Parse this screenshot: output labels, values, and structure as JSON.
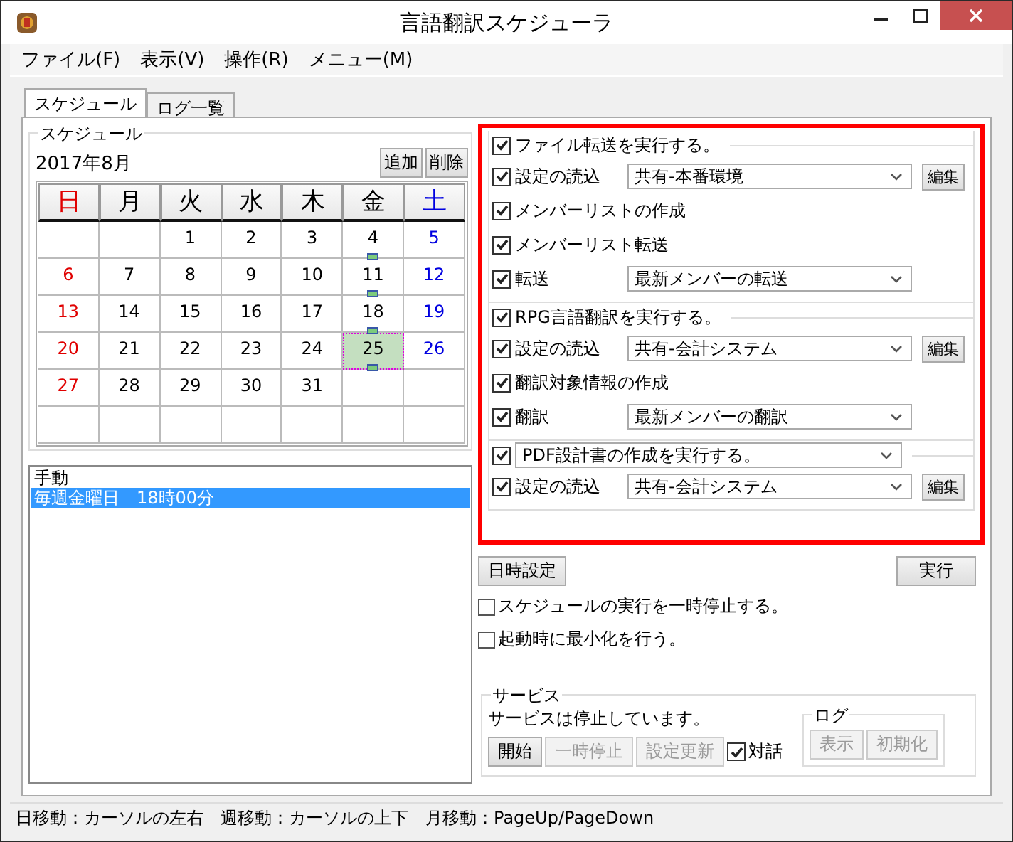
{
  "window": {
    "title": "言語翻訳スケジューラ"
  },
  "menu": [
    "ファイル(F)",
    "表示(V)",
    "操作(R)",
    "メニュー(M)"
  ],
  "tabs": [
    {
      "label": "スケジュール",
      "selected": true
    },
    {
      "label": "ログ一覧",
      "selected": false
    }
  ],
  "schedule": {
    "group_title": "スケジュール",
    "month": "2017年8月",
    "add_button": "追加",
    "delete_button": "削除",
    "weekdays": [
      {
        "label": "日",
        "kind": "sunday"
      },
      {
        "label": "月",
        "kind": "weekday"
      },
      {
        "label": "火",
        "kind": "weekday"
      },
      {
        "label": "水",
        "kind": "weekday"
      },
      {
        "label": "木",
        "kind": "weekday"
      },
      {
        "label": "金",
        "kind": "weekday"
      },
      {
        "label": "土",
        "kind": "saturday"
      }
    ],
    "weeks": [
      [
        {
          "kind": "blank"
        },
        {
          "kind": "blank"
        },
        {
          "day": "1",
          "kind": "weekday",
          "marked": false,
          "selected": false
        },
        {
          "day": "2",
          "kind": "weekday",
          "marked": false,
          "selected": false
        },
        {
          "day": "3",
          "kind": "weekday",
          "marked": false,
          "selected": false
        },
        {
          "day": "4",
          "kind": "weekday",
          "marked": true,
          "selected": false
        },
        {
          "day": "5",
          "kind": "saturday",
          "marked": false,
          "selected": false
        }
      ],
      [
        {
          "day": "6",
          "kind": "sunday",
          "marked": false,
          "selected": false
        },
        {
          "day": "7",
          "kind": "weekday",
          "marked": false,
          "selected": false
        },
        {
          "day": "8",
          "kind": "weekday",
          "marked": false,
          "selected": false
        },
        {
          "day": "9",
          "kind": "weekday",
          "marked": false,
          "selected": false
        },
        {
          "day": "10",
          "kind": "weekday",
          "marked": false,
          "selected": false
        },
        {
          "day": "11",
          "kind": "weekday",
          "marked": true,
          "selected": false
        },
        {
          "day": "12",
          "kind": "saturday",
          "marked": false,
          "selected": false
        }
      ],
      [
        {
          "day": "13",
          "kind": "sunday",
          "marked": false,
          "selected": false
        },
        {
          "day": "14",
          "kind": "weekday",
          "marked": false,
          "selected": false
        },
        {
          "day": "15",
          "kind": "weekday",
          "marked": false,
          "selected": false
        },
        {
          "day": "16",
          "kind": "weekday",
          "marked": false,
          "selected": false
        },
        {
          "day": "17",
          "kind": "weekday",
          "marked": false,
          "selected": false
        },
        {
          "day": "18",
          "kind": "weekday",
          "marked": true,
          "selected": false
        },
        {
          "day": "19",
          "kind": "saturday",
          "marked": false,
          "selected": false
        }
      ],
      [
        {
          "day": "20",
          "kind": "sunday",
          "marked": false,
          "selected": false
        },
        {
          "day": "21",
          "kind": "weekday",
          "marked": false,
          "selected": false
        },
        {
          "day": "22",
          "kind": "weekday",
          "marked": false,
          "selected": false
        },
        {
          "day": "23",
          "kind": "weekday",
          "marked": false,
          "selected": false
        },
        {
          "day": "24",
          "kind": "weekday",
          "marked": false,
          "selected": false
        },
        {
          "day": "25",
          "kind": "weekday",
          "marked": true,
          "selected": true
        },
        {
          "day": "26",
          "kind": "saturday",
          "marked": false,
          "selected": false
        }
      ],
      [
        {
          "day": "27",
          "kind": "sunday",
          "marked": false,
          "selected": false
        },
        {
          "day": "28",
          "kind": "weekday",
          "marked": false,
          "selected": false
        },
        {
          "day": "29",
          "kind": "weekday",
          "marked": false,
          "selected": false
        },
        {
          "day": "30",
          "kind": "weekday",
          "marked": false,
          "selected": false
        },
        {
          "day": "31",
          "kind": "weekday",
          "marked": false,
          "selected": false
        },
        {
          "kind": "blank"
        },
        {
          "kind": "blank"
        }
      ],
      [
        {
          "kind": "blank"
        },
        {
          "kind": "blank"
        },
        {
          "kind": "blank"
        },
        {
          "kind": "blank"
        },
        {
          "kind": "blank"
        },
        {
          "kind": "blank"
        },
        {
          "kind": "blank"
        }
      ]
    ]
  },
  "list": {
    "items": [
      {
        "text": "手動",
        "selected": false
      },
      {
        "text": "毎週金曜日　18時00分",
        "selected": true
      }
    ]
  },
  "sections": [
    {
      "header": {
        "kind": "checkbox",
        "label": "ファイル転送を実行する。",
        "checked": true
      },
      "rows": [
        {
          "kind": "select",
          "label": "設定の読込",
          "checked": true,
          "value": "共有-本番環境",
          "button": "編集"
        },
        {
          "kind": "check",
          "label": "メンバーリストの作成",
          "checked": true
        },
        {
          "kind": "check",
          "label": "メンバーリスト転送",
          "checked": true
        },
        {
          "kind": "select",
          "label": "転送",
          "checked": true,
          "value": "最新メンバーの転送"
        }
      ]
    },
    {
      "header": {
        "kind": "checkbox",
        "label": "RPG言語翻訳を実行する。",
        "checked": true
      },
      "rows": [
        {
          "kind": "select",
          "label": "設定の読込",
          "checked": true,
          "value": "共有-会計システム",
          "button": "編集"
        },
        {
          "kind": "check",
          "label": "翻訳対象情報の作成",
          "checked": true
        },
        {
          "kind": "select",
          "label": "翻訳",
          "checked": true,
          "value": "最新メンバーの翻訳"
        }
      ]
    },
    {
      "header": {
        "kind": "dropdown",
        "value": "PDF設計書の作成を実行する。",
        "checked": true
      },
      "rows": [
        {
          "kind": "select",
          "label": "設定の読込",
          "checked": true,
          "value": "共有-会計システム",
          "button": "編集"
        }
      ]
    }
  ],
  "datetime_button": "日時設定",
  "run_button": "実行",
  "options": [
    {
      "label": "スケジュールの実行を一時停止する。",
      "checked": false
    },
    {
      "label": "起動時に最小化を行う。",
      "checked": false
    }
  ],
  "service": {
    "title": "サービス",
    "status": "サービスは停止しています。",
    "buttons": [
      {
        "label": "開始",
        "disabled": false
      },
      {
        "label": "一時停止",
        "disabled": true
      },
      {
        "label": "設定更新",
        "disabled": true
      }
    ],
    "dialog": {
      "label": "対話",
      "checked": true
    },
    "log": {
      "title": "ログ",
      "buttons": [
        {
          "label": "表示",
          "disabled": true
        },
        {
          "label": "初期化",
          "disabled": true
        }
      ]
    }
  },
  "status_bar": "日移動：カーソルの左右　週移動：カーソルの上下　月移動：PageUp/PageDown"
}
